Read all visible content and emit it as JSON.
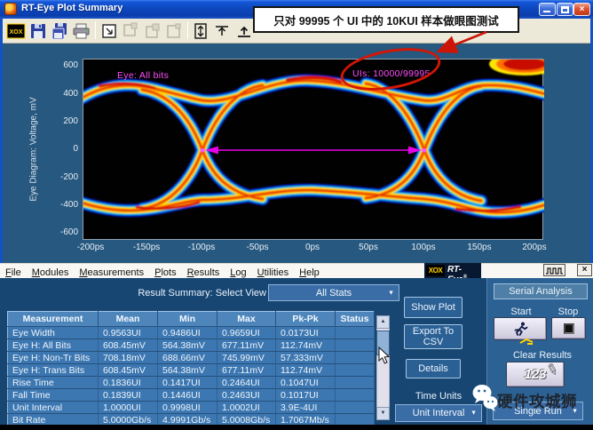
{
  "window_title": "RT-Eye Plot Summary",
  "callout_text": "只对 99995 个 UI 中的 10KUI 样本做眼图测试",
  "toolbar_icons": [
    "rt-eye-logo-icon",
    "save-icon",
    "save-all-icon",
    "print-icon",
    "export-plot-icon",
    "copy-disabled-icon",
    "paste-disabled-icon",
    "snapshot-disabled-icon",
    "fit-vertical-icon",
    "marker-icon",
    "baseline-icon"
  ],
  "plot": {
    "eye_label": "Eye: All bits",
    "uis_label": "UIs: 10000/99995",
    "y_axis_title": "Eye Diagram: Voltage, mV",
    "y_ticks": [
      "600",
      "400",
      "200",
      "0",
      "-200",
      "-400",
      "-600"
    ],
    "x_ticks": [
      "-200ps",
      "-150ps",
      "-100ps",
      "-50ps",
      "0ps",
      "50ps",
      "100ps",
      "150ps",
      "200ps"
    ]
  },
  "chart_data": {
    "type": "heatmap",
    "title": "Eye: All bits",
    "x_axis": {
      "unit": "ps",
      "ticks": [
        -200,
        -150,
        -100,
        -50,
        0,
        50,
        100,
        150,
        200
      ]
    },
    "y_axis": {
      "label": "Eye Diagram: Voltage, mV",
      "ticks": [
        600,
        400,
        200,
        0,
        -200,
        -400,
        -600
      ]
    },
    "eye_crossing_times_ps": [
      -100,
      100
    ],
    "high_rail_mV": 400,
    "low_rail_mV": -400,
    "uis_displayed": 10000,
    "uis_total": 99995
  },
  "menu": [
    "File",
    "Modules",
    "Measurements",
    "Plots",
    "Results",
    "Log",
    "Utilities",
    "Help"
  ],
  "logo": {
    "mark": "XOX",
    "brand": "RT-Eye",
    "reg": "®"
  },
  "result_summary": {
    "label": "Result Summary: Select View",
    "selected_view": "All Stats"
  },
  "table": {
    "headers": [
      "Measurement",
      "Mean",
      "Min",
      "Max",
      "Pk-Pk",
      "Status"
    ],
    "rows": [
      [
        "Eye Width",
        "0.9563UI",
        "0.9486UI",
        "0.9659UI",
        "0.0173UI",
        ""
      ],
      [
        "Eye H: All Bits",
        "608.45mV",
        "564.38mV",
        "677.11mV",
        "112.74mV",
        ""
      ],
      [
        "Eye H: Non-Tr Bits",
        "708.18mV",
        "688.66mV",
        "745.99mV",
        "57.333mV",
        ""
      ],
      [
        "Eye H: Trans Bits",
        "608.45mV",
        "564.38mV",
        "677.11mV",
        "112.74mV",
        ""
      ],
      [
        "Rise Time",
        "0.1836UI",
        "0.1417UI",
        "0.2464UI",
        "0.1047UI",
        ""
      ],
      [
        "Fall Time",
        "0.1839UI",
        "0.1446UI",
        "0.2463UI",
        "0.1017UI",
        ""
      ],
      [
        "Unit Interval",
        "1.0000UI",
        "0.9998UI",
        "1.0002UI",
        "3.9E-4UI",
        ""
      ],
      [
        "Bit Rate",
        "5.0000Gb/s",
        "4.9991Gb/s",
        "5.0008Gb/s",
        "1.7067Mb/s",
        ""
      ]
    ]
  },
  "actions": {
    "show_plot": "Show Plot",
    "export_csv": "Export To CSV",
    "details": "Details"
  },
  "time_units": {
    "label": "Time Units",
    "selected": "Unit Interval"
  },
  "serial_panel": {
    "title": "Serial Analysis",
    "start_label": "Start",
    "stop_label": "Stop",
    "clear_label": "Clear Results",
    "clear_button_text": "123",
    "run_mode": "Single Run"
  },
  "watermark_text": "硬件攻城狮",
  "colors": {
    "annotation_red": "#CC1505",
    "trace_magenta": "#FF4DFF",
    "arrow_magenta": "#E800E8",
    "titlebar_blue": "#0D47BE",
    "panel_blue": "#174673",
    "table_row_blue": "#3C77B1"
  }
}
